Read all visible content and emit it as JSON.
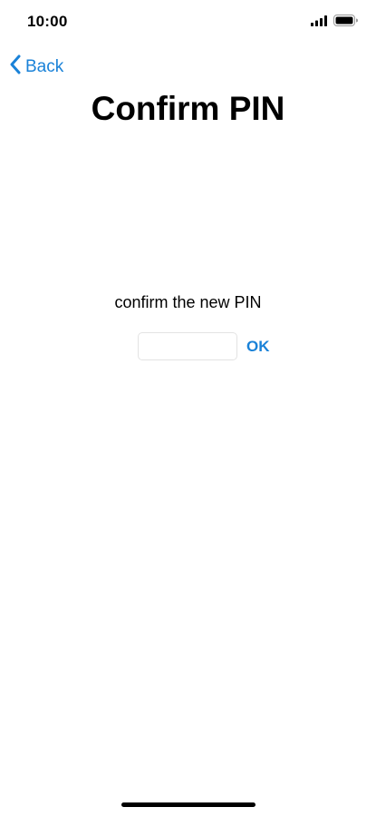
{
  "status_bar": {
    "time": "10:00",
    "signal_icon": "cellular-signal-icon",
    "battery_icon": "battery-full-icon"
  },
  "nav": {
    "back_label": "Back",
    "back_icon": "chevron-left-icon"
  },
  "page": {
    "title": "Confirm PIN",
    "prompt": "confirm the new PIN"
  },
  "pin_form": {
    "input_value": "",
    "input_placeholder": "",
    "ok_label": "OK"
  },
  "colors": {
    "accent": "#1a82d8",
    "text": "#000000",
    "input_border": "#e3e3e3",
    "background": "#ffffff"
  }
}
